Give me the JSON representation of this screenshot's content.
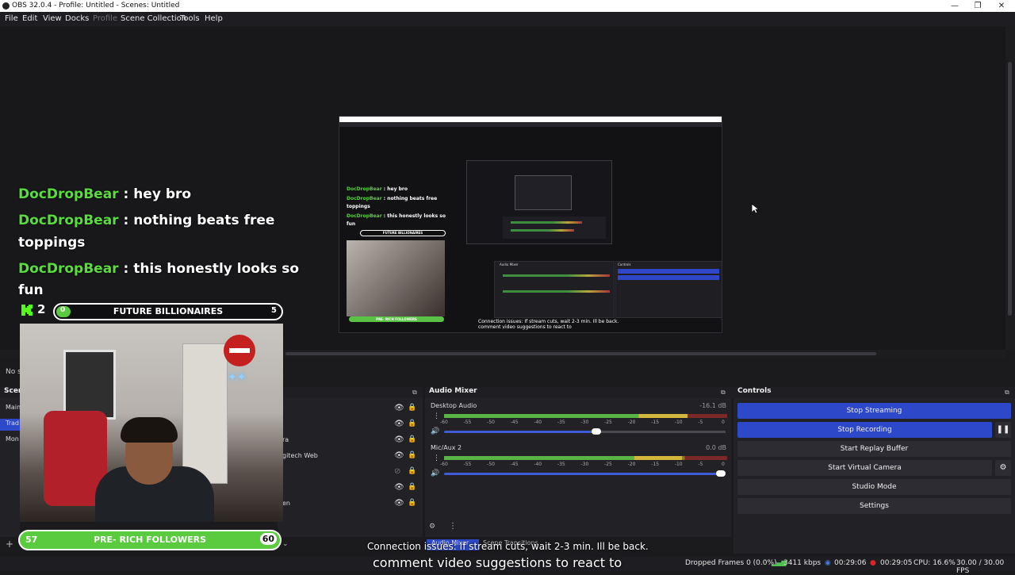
{
  "window": {
    "title": "OBS 32.0.4 - Profile: Untitled - Scenes: Untitled",
    "minimize": "—",
    "restore": "❐",
    "close": "✕"
  },
  "menu": {
    "file": "File",
    "edit": "Edit",
    "view": "View",
    "docks": "Docks",
    "profile": "Profile",
    "scene_collection": "Scene Collection",
    "tools": "Tools",
    "help": "Help"
  },
  "chat": [
    {
      "user": "DocDropBear",
      "sep": " : ",
      "text": "hey bro"
    },
    {
      "user": "DocDropBear",
      "sep": " : ",
      "text": "nothing beats free"
    },
    {
      "cont": "toppings"
    },
    {
      "user": "DocDropBear",
      "sep": " : ",
      "text": "this honestly looks so"
    },
    {
      "cont": "fun"
    }
  ],
  "kick": {
    "count": "2"
  },
  "goal_top": {
    "start": "0",
    "label": "FUTURE BILLIONAIRES",
    "end": "5"
  },
  "goal_bottom": {
    "start": "57",
    "label": "PRE- RICH FOLLOWERS",
    "end": "60"
  },
  "nested_preview": {
    "chat": [
      {
        "user": "DocDropBear",
        "text": " : hey bro"
      },
      {
        "user": "DocDropBear",
        "text": " : nothing beats free"
      },
      {
        "cont": "toppings"
      },
      {
        "user": "DocDropBear",
        "text": " : this honestly looks so"
      },
      {
        "cont": "fun"
      }
    ],
    "goal_label": "FUTURE BILLIONAIRES",
    "goal_bottom_label": "PRE- RICH FOLLOWERS",
    "mixer_title": "Audio Mixer",
    "controls_title": "Controls",
    "caption1": "Connection issues: If stream cuts, wait 2-3 min. Ill be back.",
    "caption2": "comment video suggestions to react to"
  },
  "status_strip": {
    "no_source": "No s"
  },
  "scenes": {
    "title": "Scen",
    "items": [
      "Main",
      "Trad",
      "Mon"
    ]
  },
  "sources": {
    "items": [
      "",
      "",
      "ra",
      "gitech Web",
      "",
      "",
      "en"
    ]
  },
  "mixer": {
    "title": "Audio Mixer",
    "channels": [
      {
        "name": "Desktop Audio",
        "db": "-16.1 dB",
        "level": 0.86,
        "volume": 0.54
      },
      {
        "name": "Mic/Aux 2",
        "db": "0.0 dB",
        "level": 0.84,
        "volume": 1.0
      }
    ],
    "ticks": [
      "-60",
      "-55",
      "-50",
      "-45",
      "-40",
      "-35",
      "-30",
      "-25",
      "-20",
      "-15",
      "-10",
      "-5",
      "0"
    ]
  },
  "controls": {
    "title": "Controls",
    "stop_streaming": "Stop Streaming",
    "stop_recording": "Stop Recording",
    "start_replay": "Start Replay Buffer",
    "start_virtual_camera": "Start Virtual Camera",
    "studio_mode": "Studio Mode",
    "settings": "Settings"
  },
  "bottom_tabs": {
    "audio_mixer": "Audio Mixer",
    "scene_transitions": "Scene Transitions"
  },
  "captions": {
    "line1": "Connection issues: If stream cuts, wait 2-3 min. Ill be back.",
    "line2": "comment video suggestions to react to"
  },
  "statusbar": {
    "dropped": "Dropped Frames 0 (0.0%)",
    "kbps": "3411 kbps",
    "stream_time": "00:29:06",
    "rec_time": "00:29:05",
    "cpu": "CPU: 16.6%",
    "fps": "30.00 / 30.00 FPS"
  },
  "colors": {
    "accent": "#2d48c8",
    "chat_user": "#58dd3c",
    "goal_green": "#5acb3e",
    "rec_red": "#e02424"
  }
}
